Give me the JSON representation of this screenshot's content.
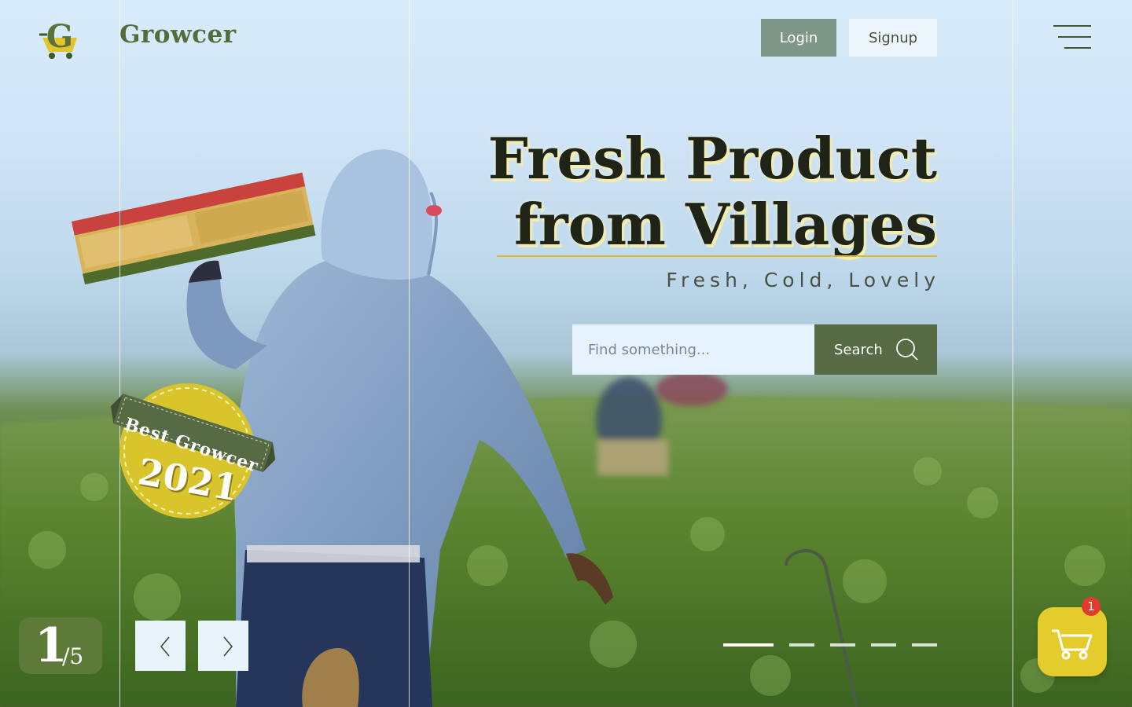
{
  "brand": {
    "name": "Growcer",
    "logo_letter": "G"
  },
  "nav": {
    "login_label": "Login",
    "signup_label": "Signup",
    "menu_icon": "hamburger-menu-icon"
  },
  "hero": {
    "headline_line1": "Fresh Product",
    "headline_line2": "from Villages",
    "tagline": "Fresh, Cold, Lovely"
  },
  "search": {
    "placeholder": "Find something...",
    "button_label": "Search",
    "icon": "search-icon"
  },
  "award_badge": {
    "line1": "Best Growcer",
    "line2": "2021"
  },
  "slider": {
    "current": "1",
    "total": "/5",
    "active_index": 0,
    "dot_count": 5
  },
  "cart": {
    "count": "1",
    "icon": "shopping-cart-icon"
  },
  "colors": {
    "accent_green": "#566a44",
    "accent_yellow": "#e4cc2d",
    "badge_red": "#e23a2d"
  }
}
